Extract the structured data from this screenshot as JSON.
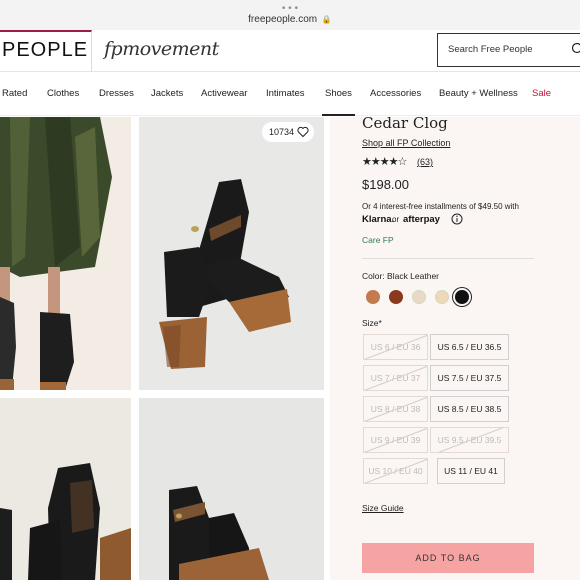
{
  "browser": {
    "dots": "•••",
    "url": "freepeople.com",
    "lock": "🔒"
  },
  "header": {
    "logo_text": "PEOPLE",
    "sub_logo_text": "fpmovement",
    "search_placeholder": "Search Free People"
  },
  "nav": {
    "items": [
      "Rated",
      "Clothes",
      "Dresses",
      "Jackets",
      "Activewear",
      "Intimates",
      "Shoes",
      "Accessories",
      "Beauty + Wellness",
      "Sale"
    ],
    "active": "Shoes"
  },
  "gallery": {
    "favorites_count": "10734"
  },
  "product": {
    "title": "Cedar Clog",
    "collection_link": "Shop all FP Collection",
    "rating_stars": "★★★★☆",
    "rating_value": 4.5,
    "reviews": "(63)",
    "price": "$198.00",
    "installments": "Or 4 interest-free installments of $49.50 with",
    "klarna": "Klarna.",
    "or": "or",
    "afterpay": "afterpay",
    "care": "Care FP",
    "color_label": "Color: Black Leather",
    "swatches": [
      {
        "name": "tan",
        "color": "#c27a4e"
      },
      {
        "name": "brown",
        "color": "#8a3a1c"
      },
      {
        "name": "light",
        "color": "#ead8c8"
      },
      {
        "name": "cream",
        "color": "#efd7b9"
      },
      {
        "name": "black",
        "color": "#111111",
        "selected": true
      }
    ],
    "size_label": "Size*",
    "sizes": [
      {
        "label": "US 6 / EU 36",
        "available": false
      },
      {
        "label": "US 6.5 / EU 36.5",
        "available": true
      },
      {
        "label": "US 7 / EU 37",
        "available": false
      },
      {
        "label": "US 7.5 / EU 37.5",
        "available": true
      },
      {
        "label": "US 8 / EU 38",
        "available": false
      },
      {
        "label": "US 8.5 / EU 38.5",
        "available": true
      },
      {
        "label": "US 9 / EU 39",
        "available": false
      },
      {
        "label": "US 9.5 / EU 39.5",
        "available": false
      },
      {
        "label": "US 10 / EU 40",
        "available": false
      },
      {
        "label": "US 11 / EU 41",
        "available": true
      }
    ],
    "size_guide": "Size Guide",
    "add_to_bag": "ADD TO BAG"
  }
}
